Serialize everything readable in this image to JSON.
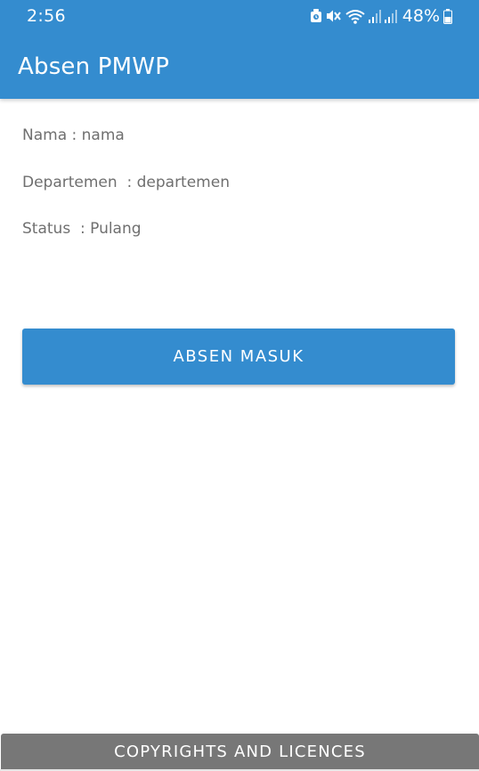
{
  "status_bar": {
    "time": "2:56",
    "battery_percent": "48%",
    "icons": [
      "alarm-icon",
      "mute-icon",
      "wifi-icon",
      "signal-icon",
      "signal-icon",
      "battery-icon"
    ]
  },
  "app": {
    "title": "Absen PMWP"
  },
  "info": {
    "nama": "Nama : nama",
    "departemen": "Departemen  : departemen",
    "status": "Status  : Pulang"
  },
  "actions": {
    "absen_label": "ABSEN MASUK",
    "footer_label": "COPYRIGHTS AND LICENCES"
  },
  "colors": {
    "primary": "#348ccf",
    "footer": "#777777",
    "text_secondary": "#6f6f6f"
  }
}
